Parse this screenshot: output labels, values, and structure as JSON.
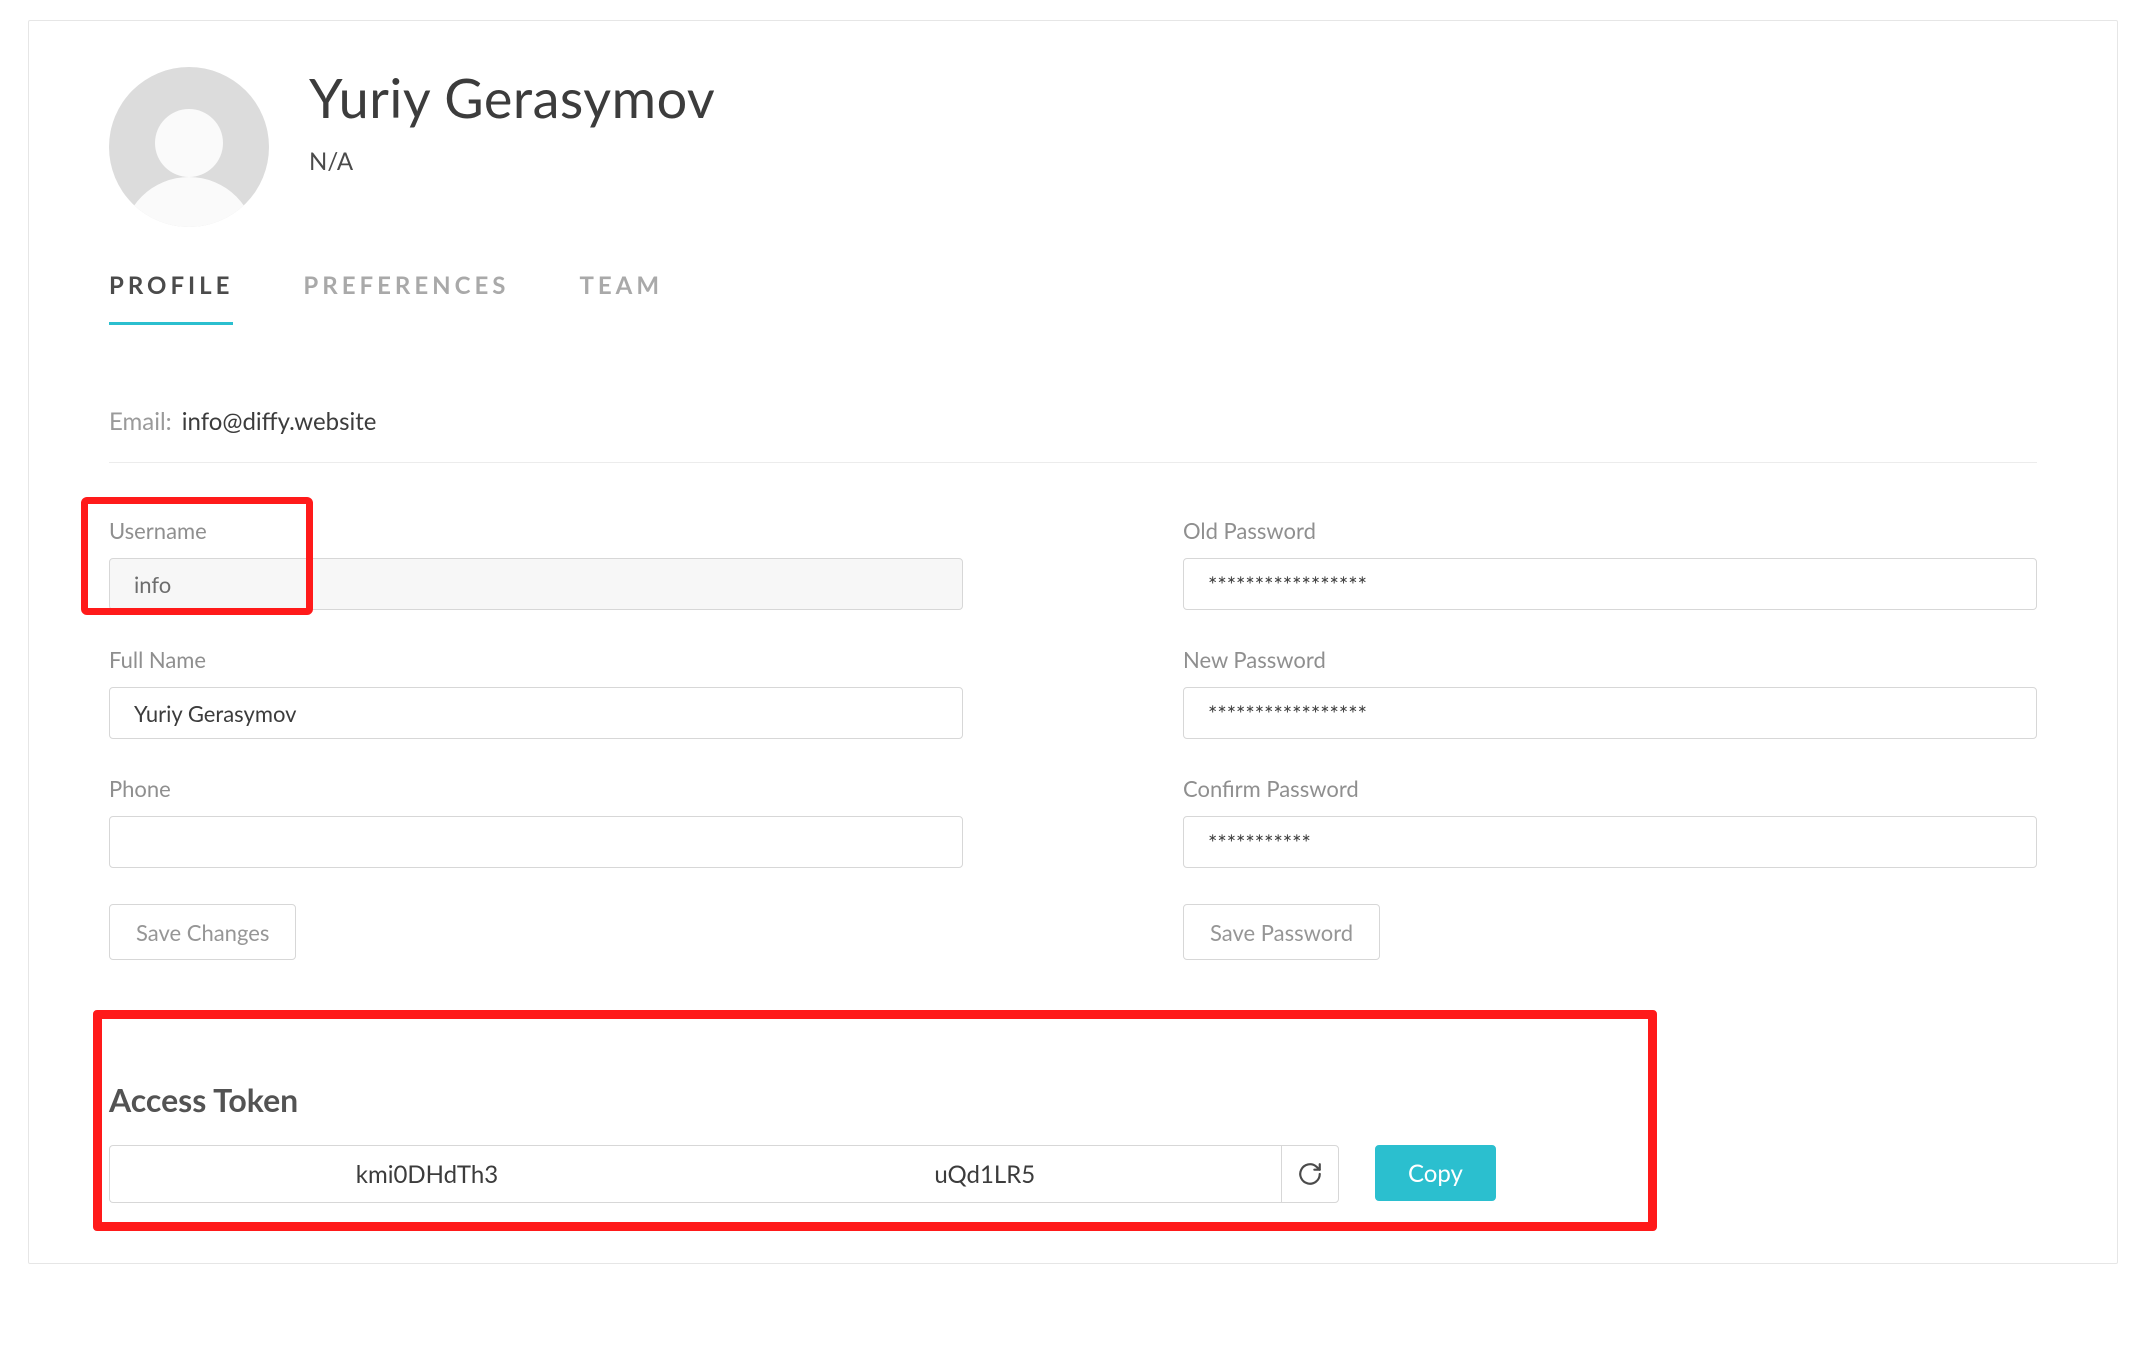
{
  "user": {
    "display_name": "Yuriy Gerasymov",
    "subtitle": "N/A"
  },
  "tabs": {
    "profile": "Profile",
    "preferences": "Preferences",
    "team": "Team"
  },
  "email": {
    "label": "Email:",
    "value": "info@diffy.website"
  },
  "profile_form": {
    "username_label": "Username",
    "username_value": "info",
    "fullname_label": "Full Name",
    "fullname_value": "Yuriy Gerasymov",
    "phone_label": "Phone",
    "phone_value": "",
    "save_changes": "Save Changes"
  },
  "password_form": {
    "old_label": "Old Password",
    "old_value": "*****************",
    "new_label": "New Password",
    "new_value": "*****************",
    "confirm_label": "Confirm Password",
    "confirm_value": "***********",
    "save_password": "Save Password"
  },
  "token": {
    "section_title": "Access Token",
    "value": "kmi0DHdTh3                                                                       uQd1LR5",
    "copy_label": "Copy"
  }
}
